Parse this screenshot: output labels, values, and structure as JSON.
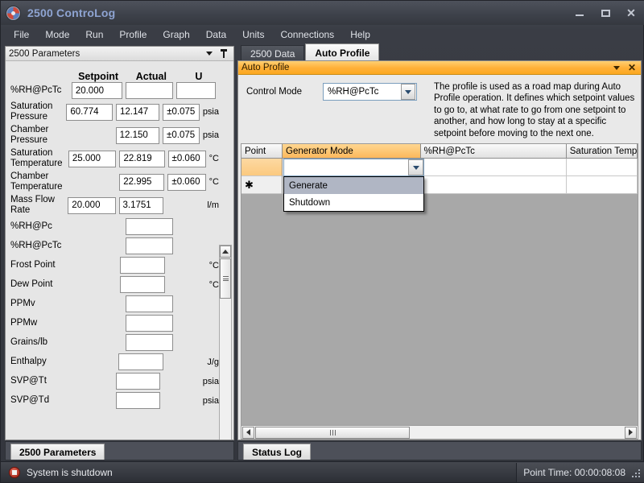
{
  "window": {
    "title": "2500 ControoLog",
    "title_display": "2500 ControLog",
    "icon": "app-globe-icon",
    "minimize": "–",
    "maximize": "▭",
    "close": "✕"
  },
  "menubar": {
    "items": [
      {
        "label": "File"
      },
      {
        "label": "Mode"
      },
      {
        "label": "Run"
      },
      {
        "label": "Profile"
      },
      {
        "label": "Graph"
      },
      {
        "label": "Data"
      },
      {
        "label": "Units"
      },
      {
        "label": "Connections"
      },
      {
        "label": "Help"
      }
    ]
  },
  "left_panel": {
    "caption": "2500 Parameters",
    "headers": {
      "label": "",
      "setpoint": "Setpoint",
      "actual": "Actual",
      "u": "U"
    },
    "rows": [
      {
        "label": "%RH@PcTc",
        "setpoint": "20.000",
        "actual": "",
        "u": "",
        "unit": "",
        "has_sp": true,
        "has_act": true,
        "has_u": true
      },
      {
        "label": "Saturation Pressure",
        "setpoint": "60.774",
        "actual": "12.147",
        "u": "±0.075",
        "unit": "psia",
        "has_sp": true,
        "has_act": true,
        "has_u": true
      },
      {
        "label": "Chamber Pressure",
        "setpoint": "",
        "actual": "12.150",
        "u": "±0.075",
        "unit": "psia",
        "has_sp": false,
        "has_act": true,
        "has_u": true
      },
      {
        "label": "Saturation Temperature",
        "setpoint": "25.000",
        "actual": "22.819",
        "u": "±0.060",
        "unit": "°C",
        "has_sp": true,
        "has_act": true,
        "has_u": true
      },
      {
        "label": "Chamber Temperature",
        "setpoint": "",
        "actual": "22.995",
        "u": "±0.060",
        "unit": "°C",
        "has_sp": false,
        "has_act": true,
        "has_u": true
      },
      {
        "label": "Mass Flow Rate",
        "setpoint": "20.000",
        "actual": "3.1751",
        "u": "",
        "unit": "l/m",
        "has_sp": true,
        "has_act": true,
        "has_u": false
      },
      {
        "label": "%RH@Pc",
        "setpoint": "",
        "actual": "",
        "u": "",
        "unit": "",
        "has_sp": false,
        "has_act": true,
        "has_u": false
      },
      {
        "label": "%RH@PcTc",
        "setpoint": "",
        "actual": "",
        "u": "",
        "unit": "",
        "has_sp": false,
        "has_act": true,
        "has_u": false
      },
      {
        "label": "Frost Point",
        "setpoint": "",
        "actual": "",
        "u": "",
        "unit": "°C",
        "has_sp": false,
        "has_act": true,
        "has_u": false
      },
      {
        "label": "Dew Point",
        "setpoint": "",
        "actual": "",
        "u": "",
        "unit": "°C",
        "has_sp": false,
        "has_act": true,
        "has_u": false
      },
      {
        "label": "PPMv",
        "setpoint": "",
        "actual": "",
        "u": "",
        "unit": "",
        "has_sp": false,
        "has_act": true,
        "has_u": false
      },
      {
        "label": "PPMw",
        "setpoint": "",
        "actual": "",
        "u": "",
        "unit": "",
        "has_sp": false,
        "has_act": true,
        "has_u": false
      },
      {
        "label": "Grains/lb",
        "setpoint": "",
        "actual": "",
        "u": "",
        "unit": "",
        "has_sp": false,
        "has_act": true,
        "has_u": false
      },
      {
        "label": "Enthalpy",
        "setpoint": "",
        "actual": "",
        "u": "",
        "unit": "J/g",
        "has_sp": false,
        "has_act": true,
        "has_u": false
      },
      {
        "label": "SVP@Tt",
        "setpoint": "",
        "actual": "",
        "u": "",
        "unit": "psia",
        "has_sp": false,
        "has_act": true,
        "has_u": false
      },
      {
        "label": "SVP@Td",
        "setpoint": "",
        "actual": "",
        "u": "",
        "unit": "psia",
        "has_sp": false,
        "has_act": true,
        "has_u": false
      }
    ],
    "bottom_tab": "2500 Parameters"
  },
  "right_panel": {
    "tabs": [
      {
        "label": "2500 Data",
        "active": false
      },
      {
        "label": "Auto Profile",
        "active": true
      }
    ],
    "caption": "Auto Profile",
    "control_mode": {
      "label": "Control Mode",
      "value": "%RH@PcTc"
    },
    "description": "The profile is used as a road map during Auto Profile operation. It defines which setpoint values to go to, at what rate to go from one setpoint to another, and how long to stay at a specific setpoint before moving to the next one.",
    "grid": {
      "columns": [
        {
          "label": "Point",
          "highlight": false
        },
        {
          "label": "Generator Mode",
          "highlight": true
        },
        {
          "label": "%RH@PcTc",
          "highlight": false
        },
        {
          "label": "Saturation Tempe",
          "highlight": false
        }
      ],
      "rows": [
        {
          "point": "",
          "mode": "",
          "rh": "",
          "sat": "",
          "current": true
        },
        {
          "point": "✱",
          "mode": "",
          "rh": "",
          "sat": "",
          "current": false
        }
      ],
      "editor_value": "",
      "dropdown_options": [
        {
          "label": "Generate",
          "selected": true
        },
        {
          "label": "Shutdown",
          "selected": false
        }
      ]
    },
    "bottom_tab": "Status Log"
  },
  "statusbar": {
    "icon": "stop-circle-icon",
    "message": "System is shutdown",
    "point_time": "Point Time: 00:00:08:08"
  },
  "colors": {
    "accent_orange": "#fcb85c",
    "title_text": "#8ea4d2",
    "chrome_dark": "#3a3d45",
    "panel_bg": "#e6e6e6",
    "status_red": "#9d1f13"
  }
}
